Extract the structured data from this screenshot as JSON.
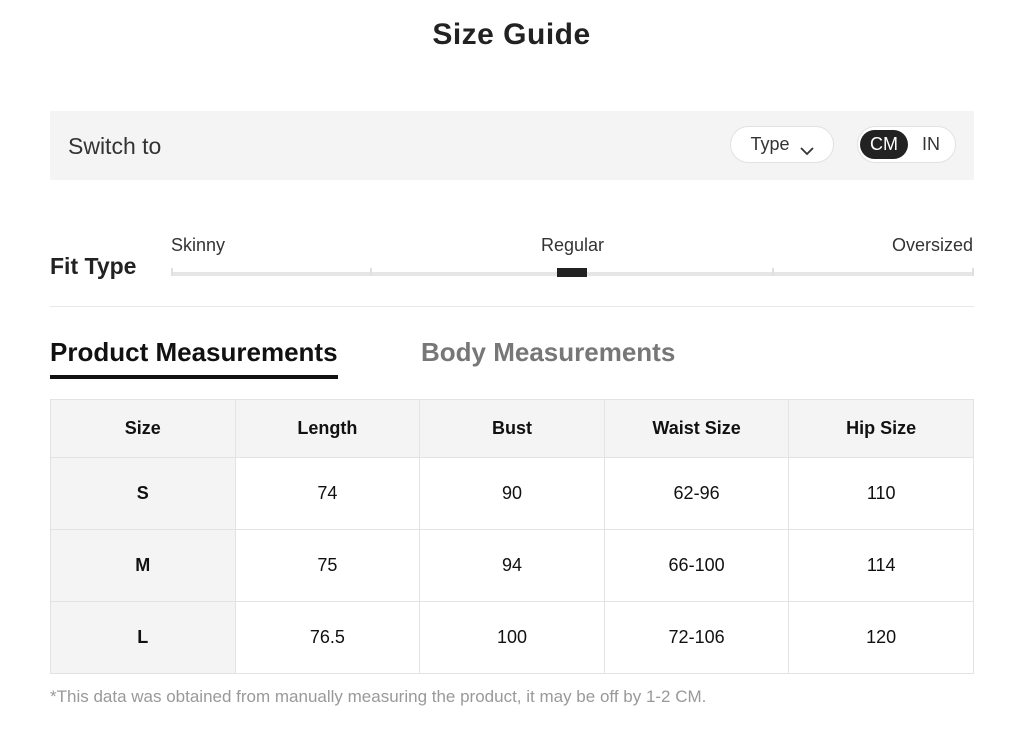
{
  "title": "Size Guide",
  "switch_bar": {
    "label": "Switch to",
    "type_dropdown": {
      "label": "Type",
      "icon": "chevron-down-icon"
    },
    "units": {
      "options": [
        "CM",
        "IN"
      ],
      "selected": "CM"
    }
  },
  "fit_type": {
    "heading": "Fit Type",
    "labels": {
      "skinny": "Skinny",
      "regular": "Regular",
      "oversized": "Oversized"
    },
    "selected": "Regular"
  },
  "tabs": [
    {
      "label": "Product Measurements",
      "active": true
    },
    {
      "label": "Body Measurements",
      "active": false
    }
  ],
  "table": {
    "headers": [
      "Size",
      "Length",
      "Bust",
      "Waist Size",
      "Hip Size"
    ],
    "rows": [
      [
        "S",
        "74",
        "90",
        "62-96",
        "110"
      ],
      [
        "M",
        "75",
        "94",
        "66-100",
        "114"
      ],
      [
        "L",
        "76.5",
        "100",
        "72-106",
        "120"
      ]
    ]
  },
  "footnote": "*This data was obtained from manually measuring the product, it may be off by 1-2 CM.",
  "colors": {
    "accent": "#222222",
    "panel_bg": "#f4f4f4",
    "muted_text": "#999999",
    "inactive_tab": "#777777"
  }
}
